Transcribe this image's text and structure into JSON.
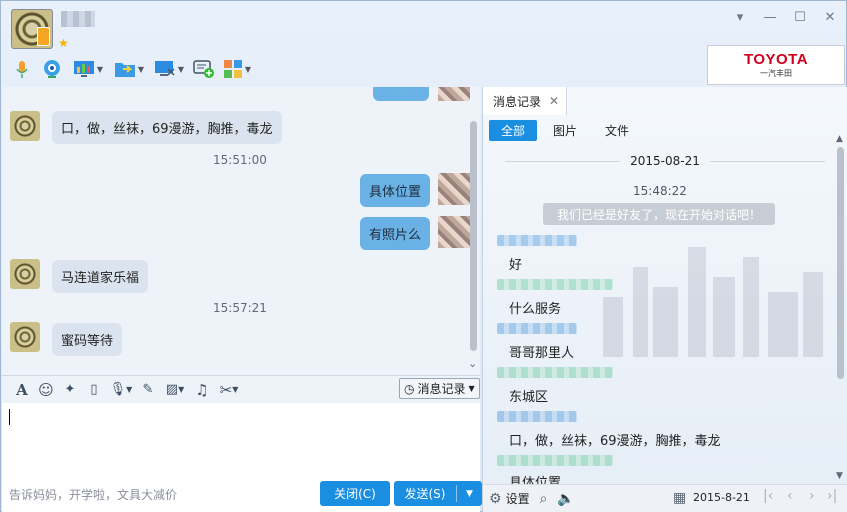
{
  "window": {
    "controls": [
      "▾",
      "—",
      "☐",
      "✕"
    ]
  },
  "ad": {
    "title": "TOYOTA",
    "subtitle": "一汽丰田"
  },
  "chat": {
    "messages": [
      {
        "side": "left",
        "text": "口，做，丝袜，69漫游，胸推，毒龙"
      },
      {
        "side": "time",
        "text": "15:51:00"
      },
      {
        "side": "right",
        "text": "具体位置"
      },
      {
        "side": "right",
        "text": "有照片么"
      },
      {
        "side": "left",
        "text": "马连道家乐福"
      },
      {
        "side": "time",
        "text": "15:57:21"
      },
      {
        "side": "left",
        "text": "蜜码等待"
      }
    ]
  },
  "input_toolbar": {
    "history_label": "消息记录"
  },
  "footer": {
    "ad_text": "告诉妈妈，开学啦，文具大减价",
    "close_label": "关闭(C)",
    "send_label": "发送(S)"
  },
  "history": {
    "tab_label": "消息记录",
    "filters": [
      "全部",
      "图片",
      "文件"
    ],
    "date": "2015-08-21",
    "time": "15:48:22",
    "system_message": "我们已经是好友了，现在开始对话吧！",
    "entries": [
      {
        "color": "blue",
        "text": "好"
      },
      {
        "color": "green",
        "text": "什么服务"
      },
      {
        "color": "blue",
        "text": "哥哥那里人"
      },
      {
        "color": "green",
        "text": "东城区"
      },
      {
        "color": "blue",
        "text": "口，做，丝袜，69漫游，胸推，毒龙"
      },
      {
        "color": "green",
        "text": "具体位置"
      }
    ],
    "footer_settings": "设置",
    "footer_date": "2015-8-21"
  }
}
